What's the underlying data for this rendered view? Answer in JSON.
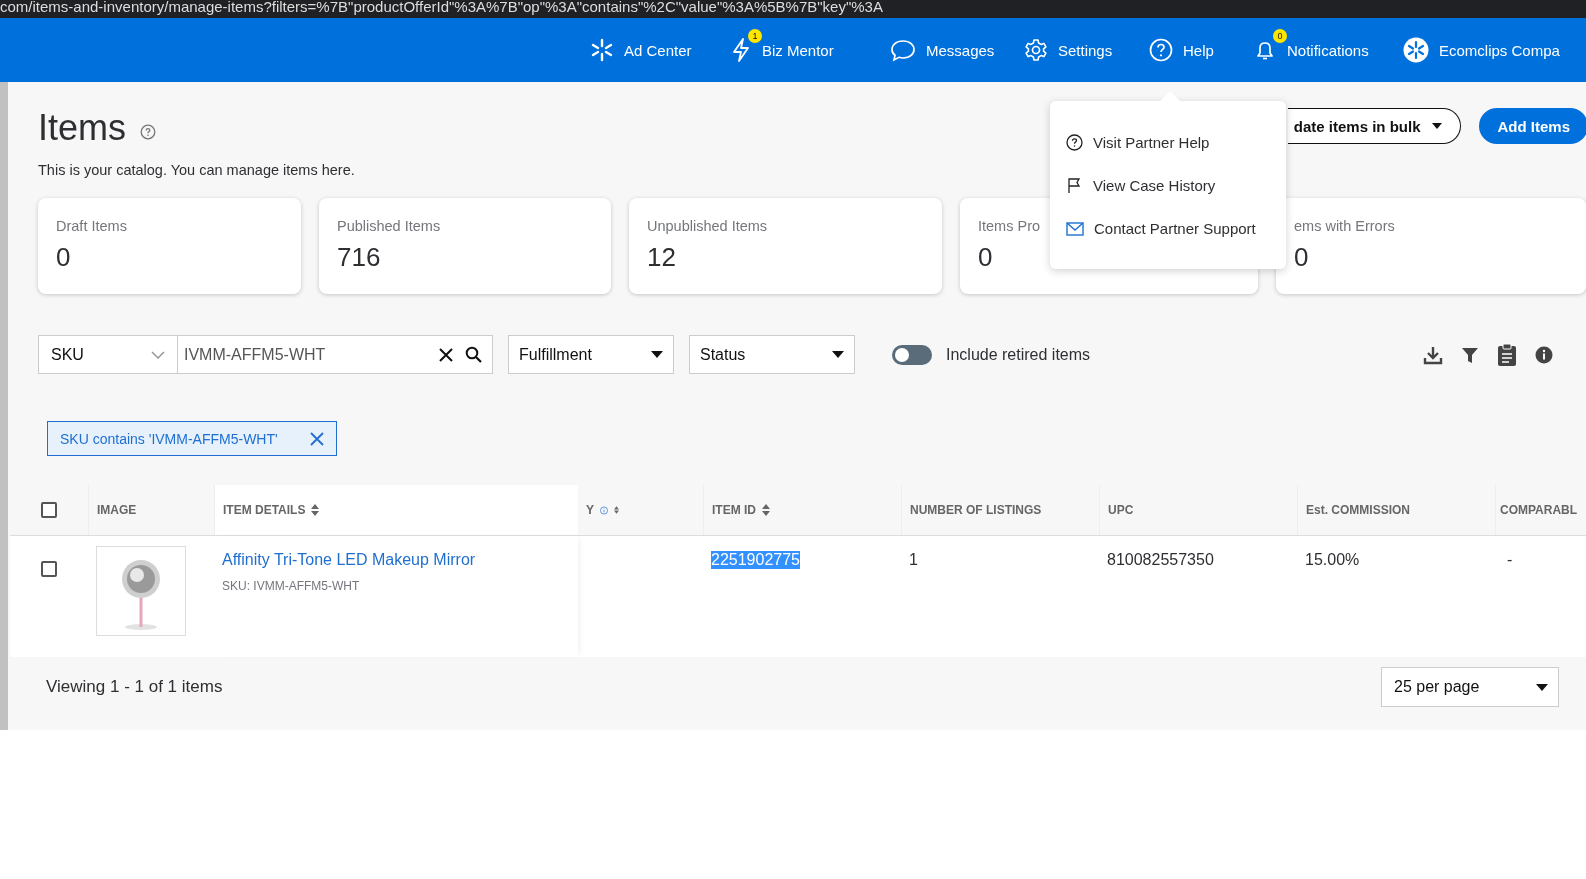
{
  "browser": {
    "url": "com/items-and-inventory/manage-items?filters=%7B\"productOfferId\"%3A%7B\"op\"%3A\"contains\"%2C\"value\"%3A%5B%7B\"key\"%3A"
  },
  "nav": {
    "items": [
      {
        "label": "Ad Center"
      },
      {
        "label": "Biz Mentor",
        "badge": "1"
      },
      {
        "label": "Messages"
      },
      {
        "label": "Settings"
      },
      {
        "label": "Help"
      },
      {
        "label": "Notifications",
        "badge": "0"
      },
      {
        "label": "Ecomclips Compa"
      }
    ]
  },
  "page": {
    "title": "Items",
    "subtitle": "This is your catalog. You can manage items here.",
    "actions": [
      {
        "label": "date items in bulk",
        "kind": "outline"
      },
      {
        "label": "Add Items",
        "kind": "primary"
      }
    ]
  },
  "stats": [
    {
      "label": "Draft Items",
      "value": "0"
    },
    {
      "label": "Published Items",
      "value": "716"
    },
    {
      "label": "Unpublished Items",
      "value": "12"
    },
    {
      "label": "Items Pro",
      "value": "0"
    },
    {
      "label": "ems with Errors",
      "value": "0"
    }
  ],
  "filters": {
    "field_select": {
      "value": "SKU"
    },
    "search": {
      "value": "IVMM-AFFM5-WHT"
    },
    "dropdowns": [
      "Fulfillment",
      "Status"
    ],
    "toggle": {
      "label": "Include retired items",
      "on": false
    }
  },
  "active_filters": [
    {
      "label": "SKU contains 'IVMM-AFFM5-WHT'"
    }
  ],
  "table": {
    "select_all": {
      "checked": false
    },
    "columns": [
      {
        "label": "IMAGE",
        "sortable": false,
        "info": false
      },
      {
        "label": "ITEM DETAILS",
        "sortable": true,
        "info": false
      },
      {
        "label": "Y",
        "sortable": true,
        "info": true
      },
      {
        "label": "ITEM ID",
        "sortable": true,
        "info": false
      },
      {
        "label": "NUMBER OF LISTINGS",
        "sortable": false,
        "info": false
      },
      {
        "label": "UPC",
        "sortable": false,
        "info": false
      },
      {
        "label": "Est. COMMISSION",
        "sortable": false,
        "info": false
      },
      {
        "label": "COMPARABL",
        "sortable": false,
        "info": false
      }
    ],
    "rows": [
      {
        "checked": false,
        "title": "Affinity Tri-Tone LED Makeup Mirror",
        "sku": "SKU: IVMM-AFFM5-WHT",
        "item_id": "2251902775",
        "item_id_highlighted": true,
        "listings": "1",
        "upc": "810082557350",
        "commission": "15.00%",
        "comparable": "-"
      }
    ]
  },
  "footer": {
    "summary": "Viewing 1 - 1 of 1 items",
    "per_page": "25 per page"
  },
  "help_menu": {
    "items": [
      {
        "label": "Visit Partner Help"
      },
      {
        "label": "View Case History"
      },
      {
        "label": "Contact Partner Support"
      }
    ]
  }
}
